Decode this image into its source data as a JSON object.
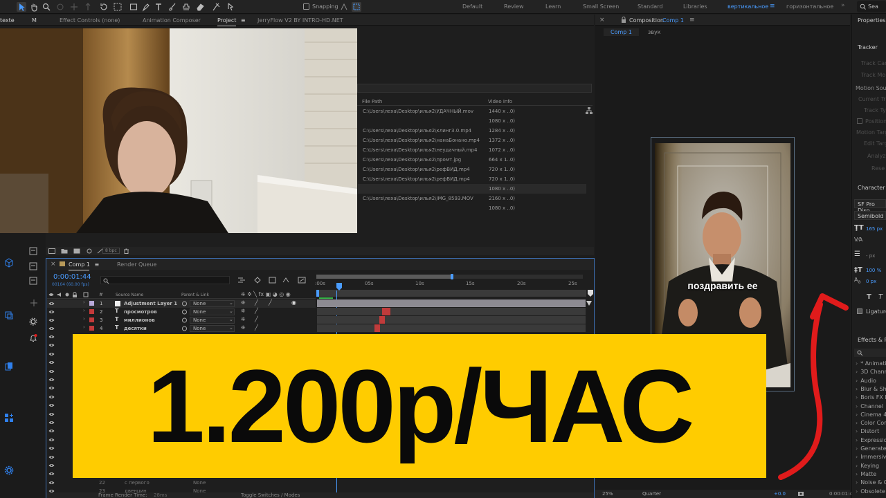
{
  "toolbar": {
    "snapping_label": "Snapping",
    "workspaces": [
      "Default",
      "Review",
      "Learn",
      "Small Screen",
      "Standard",
      "Libraries",
      "вертикальное",
      "горизонтальное"
    ],
    "active_workspace": "вертикальное",
    "search_label": "Sea"
  },
  "left_panel": {
    "tabs": [
      "Effect Controls (none)",
      "Animation Composer",
      "Project",
      "JerryFlow V2 BY INTRO-HD.NET"
    ],
    "cut_tab": "texte",
    "cut_tab2": "M",
    "active_tab": "Project"
  },
  "project": {
    "col_file_path": "File Path",
    "col_video_info": "Video Info",
    "rows": [
      {
        "path": "C:\\Users\\леха\\Desktop\\илья2\\УДАЧНЫЙ.mov",
        "info": "1440 x ..0)"
      },
      {
        "path": "",
        "info": "1080 x ..0)"
      },
      {
        "path": "C:\\Users\\леха\\Desktop\\илья2\\клинг3.0.mp4",
        "info": "1284 x ..0)"
      },
      {
        "path": "C:\\Users\\леха\\Desktop\\илья2\\нанаБонано.mp4",
        "info": "1372 x ..0)"
      },
      {
        "path": "C:\\Users\\леха\\Desktop\\илья2\\неудачный.mp4",
        "info": "1072 x ..0)"
      },
      {
        "path": "C:\\Users\\леха\\Desktop\\илья2\\промт.jpg",
        "info": "664 x 1..0)"
      },
      {
        "path": "C:\\Users\\леха\\Desktop\\илья2\\рефВИД.mp4",
        "info": "720 x 1..0)"
      },
      {
        "path": "C:\\Users\\леха\\Desktop\\илья2\\рефВИД.mp4",
        "info": "720 x 1..0)"
      },
      {
        "path": "",
        "info": "1080 x ..0)"
      },
      {
        "path": "C:\\Users\\леха\\Desktop\\илья2\\IMG_8593.MOV",
        "info": "2160 x ..0)"
      },
      {
        "path": "",
        "info": "1080 x ..0)"
      }
    ],
    "bpc": "8 bpc"
  },
  "timeline": {
    "tab_comp": "Comp 1",
    "tab_render": "Render Queue",
    "timecode": "0:00:01:44",
    "frame_info": "00104 (60.00 fps)",
    "search_placeholder": "",
    "col_num": "#",
    "col_source": "Source Name",
    "col_parent": "Parent & Link",
    "ruler": [
      ":00s",
      "05s",
      "10s",
      "15s",
      "20s",
      "25s"
    ],
    "layers": [
      {
        "num": "1",
        "name": "Adjustment Layer 1",
        "parent": "None",
        "color": "#b9a9d9",
        "type": "box"
      },
      {
        "num": "2",
        "name": "просмотров",
        "parent": "None",
        "color": "#c53a3a",
        "type": "T"
      },
      {
        "num": "3",
        "name": "миллионов",
        "parent": "None",
        "color": "#c53a3a",
        "type": "T"
      },
      {
        "num": "4",
        "name": "десятки",
        "parent": "None",
        "color": "#c53a3a",
        "type": "T"
      }
    ],
    "bottom_layers": [
      {
        "num": "22",
        "name": "с первого",
        "parent": "None"
      },
      {
        "num": "23",
        "name": "двенцин",
        "parent": "None"
      }
    ],
    "footer_render": "Frame Render Time:",
    "footer_render_val": "28ms",
    "footer_toggle": "Toggle Switches / Modes"
  },
  "composition": {
    "panel_title": "Composition",
    "comp_name": "Comp 1",
    "tabs": [
      "Comp 1",
      "звук"
    ],
    "caption": "поздравить ее",
    "zoom": "25%",
    "resolution": "Quarter",
    "exposure": "+0.0",
    "timecode_small": "0:00:01:4"
  },
  "banner": {
    "text": "1.200р/ЧАС"
  },
  "right_panel": {
    "properties": "Properties:",
    "tracker": "Tracker",
    "tracker_items": [
      "Track Cam",
      "Track Mo",
      "Motion Sour",
      "Current Tra",
      "Track Ty",
      "Position",
      "Motion Targ",
      "Edit Targ",
      "Analyz",
      "Rese"
    ],
    "character": "Character",
    "font_name": "SF Pro Disp",
    "font_style": "Semibold",
    "font_size": "165 px",
    "leading": "- px",
    "scale": "100 %",
    "baseline": "0 px",
    "ligatures": "Ligature",
    "effects_title": "Effects & Pr",
    "effects": [
      "* Animation",
      "3D Channe",
      "Audio",
      "Blur & Sha",
      "Boris FX M",
      "Channel",
      "Cinema 4D",
      "Color Corre",
      "Distort",
      "Expression",
      "Generate",
      "Immersive",
      "Keying",
      "Matte",
      "Noise & Gr",
      "Obsolete"
    ]
  },
  "colors": {
    "accent": "#4a9cff",
    "banner": "#ffcc00",
    "arrow": "#e01b1b"
  }
}
